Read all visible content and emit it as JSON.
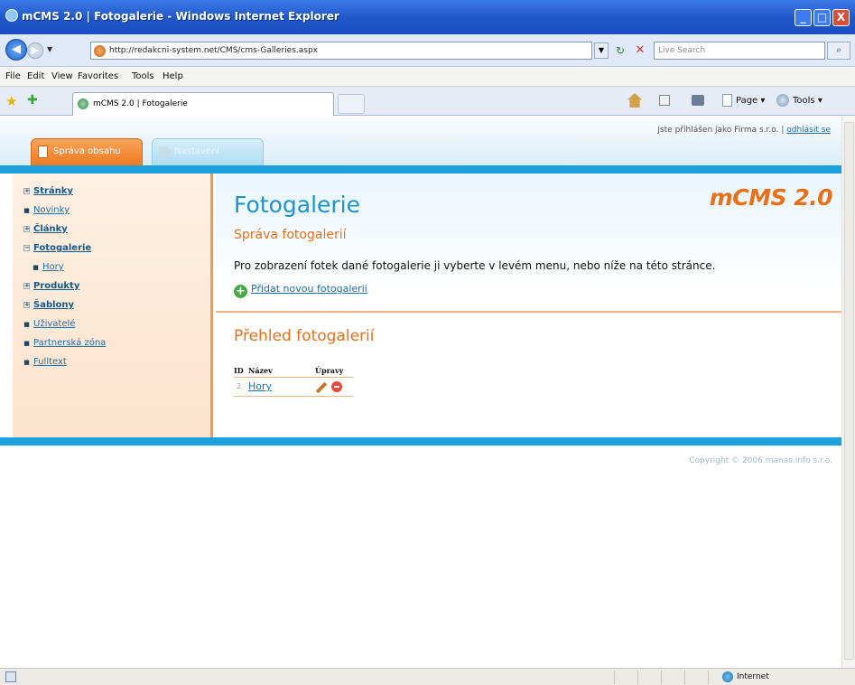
{
  "window": {
    "title": "mCMS 2.0 | Fotogalerie - Windows Internet Explorer",
    "min": "_",
    "max": "□",
    "close": "X"
  },
  "browser": {
    "url": "http://redakcni-system.net/CMS/cms-Galleries.aspx",
    "search_placeholder": "Live Search",
    "menu": [
      "File",
      "Edit",
      "View",
      "Favorites",
      "Tools",
      "Help"
    ],
    "tab_title": "mCMS 2.0 | Fotogalerie",
    "commands": [
      "Page ▾",
      "Tools ▾"
    ],
    "status_zone": "Internet"
  },
  "header": {
    "user_prefix": "Jste přihlášen jako Firma s.r.o. | ",
    "logout": "odhlásit se",
    "tabs": [
      "Správa obsahu",
      "Nastavení"
    ]
  },
  "sidebar": {
    "items": [
      {
        "label": "Stránky",
        "bullet": "+",
        "bold": true
      },
      {
        "label": "Novinky",
        "bullet": "■",
        "bold": false
      },
      {
        "label": "Články",
        "bullet": "+",
        "bold": true
      },
      {
        "label": "Fotogalerie",
        "bullet": "−",
        "bold": true
      },
      {
        "label": "Hory",
        "bullet": "■",
        "bold": false
      },
      {
        "label": "Produkty",
        "bullet": "+",
        "bold": true
      },
      {
        "label": "Šablony",
        "bullet": "+",
        "bold": true
      },
      {
        "label": "Uživatelé",
        "bullet": "■",
        "bold": false
      },
      {
        "label": "Partnerská zóna",
        "bullet": "■",
        "bold": false
      },
      {
        "label": "Fulltext",
        "bullet": "■",
        "bold": false
      }
    ]
  },
  "main": {
    "logo": "mCMS 2.0",
    "title": "Fotogalerie",
    "subtitle": "Správa fotogalerií",
    "intro": "Pro zobrazení fotek dané fotogalerie ji vyberte v levém menu, nebo níže na této stránce.",
    "add_link": "Přidat novou fotogalerii",
    "overview_title": "Přehled fotogalerií",
    "table": {
      "headers": [
        "ID",
        "Název",
        "Úpravy"
      ],
      "rows": [
        {
          "id": "2",
          "name": "Hory"
        }
      ]
    }
  },
  "footer": {
    "copyright": "Copyright © 2006 manas.info s.r.o."
  },
  "colors": {
    "accent_orange": "#e8701a",
    "accent_blue": "#1ca1dc",
    "link": "#1a6fa8"
  }
}
